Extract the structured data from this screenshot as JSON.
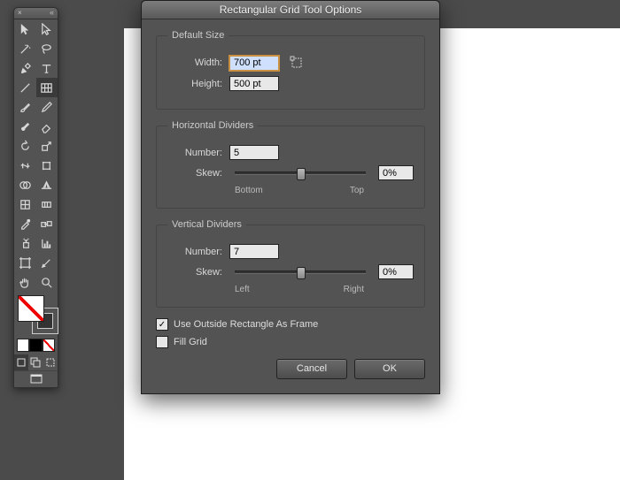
{
  "tools_header": {
    "collapse": "«",
    "close": "×"
  },
  "dialog": {
    "title": "Rectangular Grid Tool Options",
    "default_size": {
      "legend": "Default Size",
      "width_label": "Width:",
      "width_value": "700 pt",
      "height_label": "Height:",
      "height_value": "500 pt"
    },
    "horizontal": {
      "legend": "Horizontal Dividers",
      "number_label": "Number:",
      "number_value": "5",
      "skew_label": "Skew:",
      "skew_value": "0%",
      "lab_left": "Bottom",
      "lab_right": "Top"
    },
    "vertical": {
      "legend": "Vertical Dividers",
      "number_label": "Number:",
      "number_value": "7",
      "skew_label": "Skew:",
      "skew_value": "0%",
      "lab_left": "Left",
      "lab_right": "Right"
    },
    "use_outside_label": "Use Outside Rectangle As Frame",
    "use_outside_checked": "✓",
    "fill_grid_label": "Fill Grid",
    "cancel": "Cancel",
    "ok": "OK"
  }
}
